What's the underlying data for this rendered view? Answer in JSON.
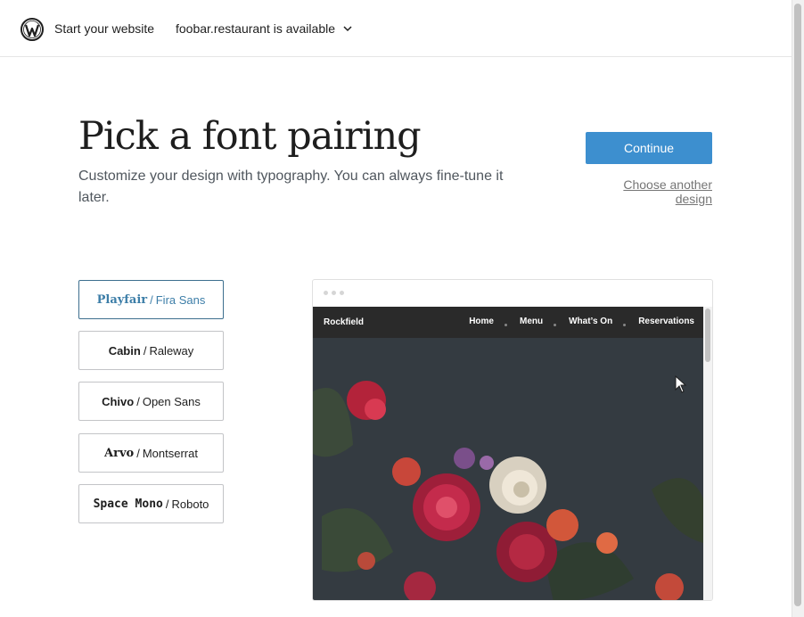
{
  "header": {
    "logo_icon": "wordpress-logo-icon",
    "title": "Start your website",
    "domain_label": "foobar.restaurant is available",
    "domain_icon": "chevron-down-icon"
  },
  "main": {
    "title": "Pick a font pairing",
    "subtitle": "Customize your design with typography. You can always fine-tune it later.",
    "continue_label": "Continue",
    "choose_another_label": "Choose another design",
    "accent_color": "#3d8fcf"
  },
  "font_options": [
    {
      "heading": "Playfair",
      "body": "Fira Sans",
      "selected": true
    },
    {
      "heading": "Cabin",
      "body": "Raleway",
      "selected": false
    },
    {
      "heading": "Chivo",
      "body": "Open Sans",
      "selected": false
    },
    {
      "heading": "Arvo",
      "body": "Montserrat",
      "selected": false
    },
    {
      "heading": "Space Mono",
      "body": "Roboto",
      "selected": false
    }
  ],
  "preview": {
    "site_name": "Rockfield",
    "nav": [
      "Home",
      "Menu",
      "What’s On",
      "Reservations"
    ],
    "hero_description": "dark floral photograph"
  },
  "separator": "/"
}
